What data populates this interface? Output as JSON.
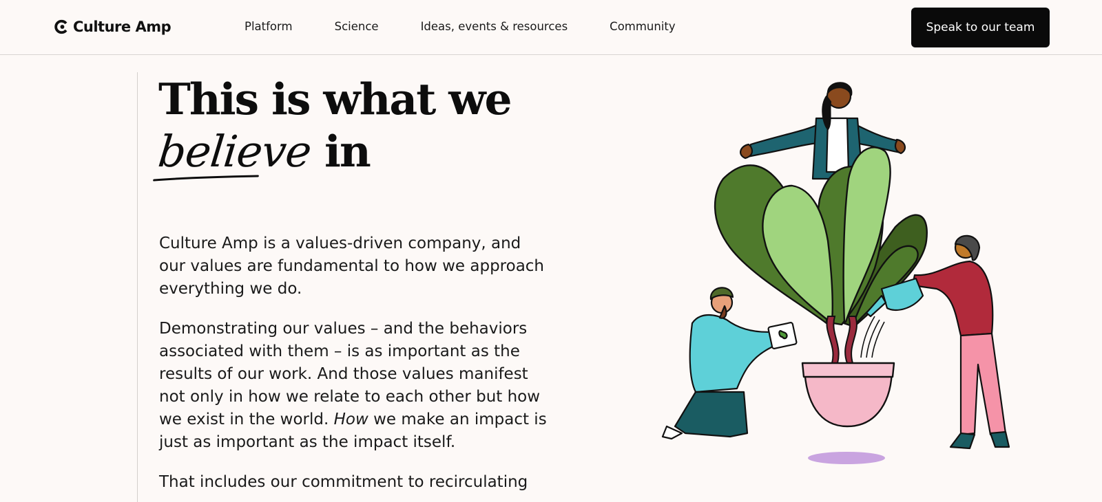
{
  "header": {
    "brand": "Culture Amp",
    "nav": [
      "Platform",
      "Science",
      "Ideas, events & resources",
      "Community"
    ],
    "cta_label": "Speak to our team"
  },
  "hero": {
    "headline_line1": "This is what we",
    "headline_script": "believe",
    "headline_end": " in"
  },
  "body": {
    "p1": "Culture Amp is a values-driven company, and our values are fundamental to how we approach everything we do.",
    "p2_before": "Demonstrating our values – and the behaviors associated with them – is as important as the results of our work. And those values manifest not only in how we relate to each other but how we exist in the world. ",
    "p2_em": "How",
    "p2_after": " we make an impact is just as important as the impact itself.",
    "p3": "That includes our commitment to recirculating"
  },
  "colors": {
    "background": "#fdf9f7",
    "cta_bg": "#0a0a0a",
    "leaf_dark": "#4f7a2c",
    "leaf_light": "#a0d47e",
    "pot_pink": "#f5b8c8",
    "jacket_red": "#b12a3b",
    "hoodie_teal": "#5ed0d8",
    "shadow_lilac": "#c9a4e0"
  },
  "icons": [
    "culture-amp-logo-icon"
  ]
}
